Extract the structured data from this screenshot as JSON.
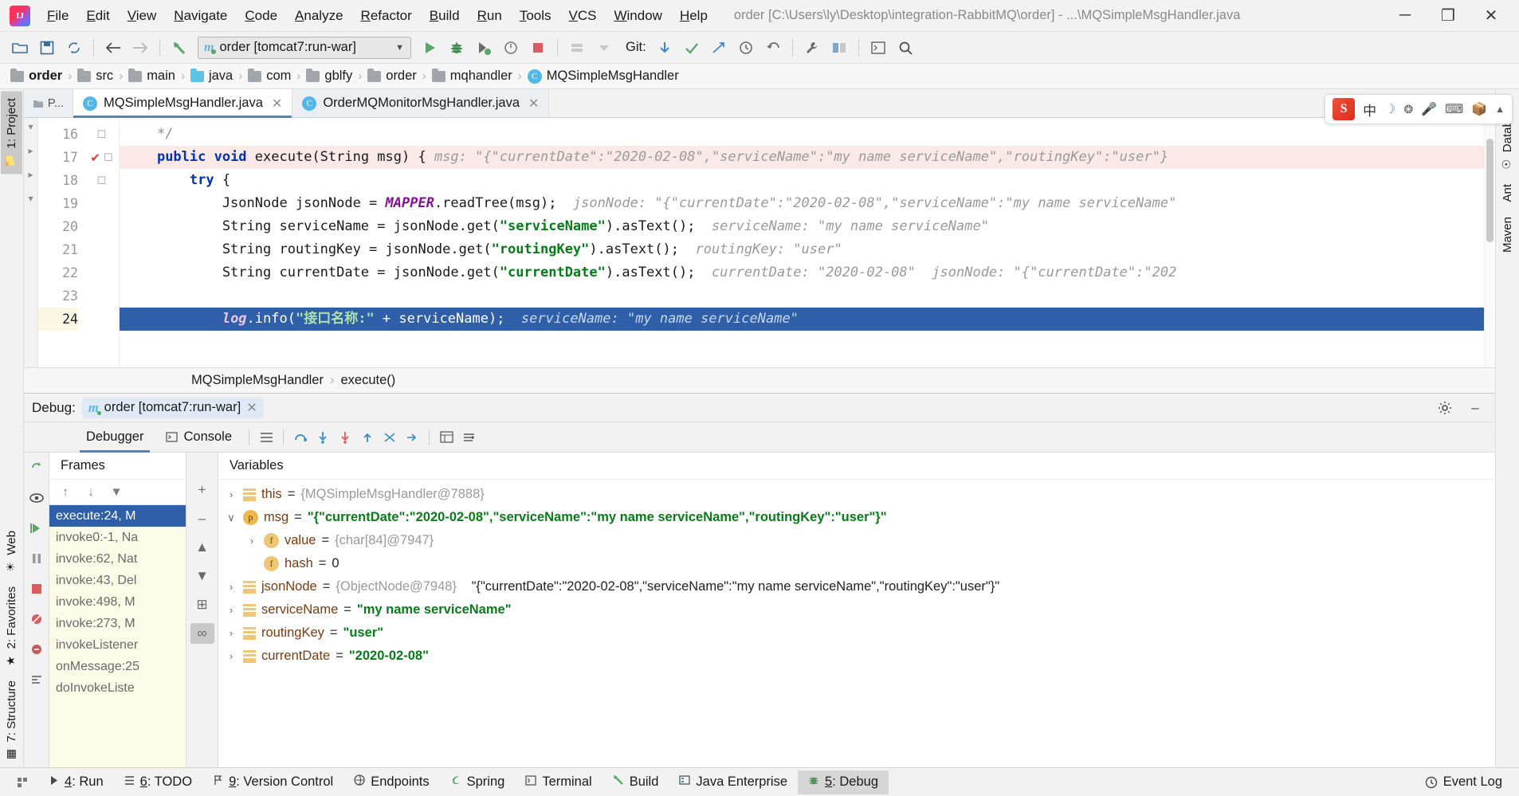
{
  "window": {
    "title": "order [C:\\Users\\ly\\Desktop\\integration-RabbitMQ\\order] - ...\\MQSimpleMsgHandler.java",
    "minimize": "─",
    "maximize": "❐",
    "close": "✕"
  },
  "menu": {
    "items": [
      "File",
      "Edit",
      "View",
      "Navigate",
      "Code",
      "Analyze",
      "Refactor",
      "Build",
      "Run",
      "Tools",
      "VCS",
      "Window",
      "Help"
    ]
  },
  "toolbar": {
    "run_config": "order [tomcat7:run-war]",
    "run_config_prefix": "m",
    "git_label": "Git:",
    "icons": [
      "open-folder-icon",
      "save-icon",
      "sync-icon",
      "back-arrow-icon",
      "forward-arrow-icon",
      "undo-arrow-icon",
      "run-icon",
      "debug-icon",
      "run-with-coverage-icon",
      "profile-icon",
      "stop-icon",
      "build-icon",
      "build-variant-icon",
      "git-update-icon",
      "git-commit-icon",
      "git-push-icon",
      "history-icon",
      "rollback-icon",
      "wrench-icon",
      "layout-icon",
      "terminal-icon",
      "search-icon"
    ]
  },
  "breadcrumb": {
    "items": [
      {
        "label": "order",
        "icon": "folder-icon"
      },
      {
        "label": "src",
        "icon": "folder-icon"
      },
      {
        "label": "main",
        "icon": "folder-icon"
      },
      {
        "label": "java",
        "icon": "folder-java-icon"
      },
      {
        "label": "com",
        "icon": "folder-icon"
      },
      {
        "label": "gblfy",
        "icon": "folder-icon"
      },
      {
        "label": "order",
        "icon": "folder-icon"
      },
      {
        "label": "mqhandler",
        "icon": "folder-icon"
      },
      {
        "label": "MQSimpleMsgHandler",
        "icon": "class-icon"
      }
    ],
    "separator": "›"
  },
  "editor_tabs": {
    "stub": "P...",
    "tabs": [
      {
        "label": "MQSimpleMsgHandler.java",
        "active": true,
        "close": "✕",
        "icon": "java-class-icon"
      },
      {
        "label": "OrderMQMonitorMsgHandler.java",
        "active": false,
        "close": "✕",
        "icon": "java-class-icon"
      }
    ]
  },
  "editor": {
    "line_numbers": [
      "16",
      "17",
      "18",
      "19",
      "20",
      "21",
      "22",
      "23",
      "24"
    ],
    "lines": [
      {
        "no": "16",
        "indent": 4,
        "segments": [
          {
            "t": "*/",
            "c": "cmt"
          }
        ],
        "style": "normal"
      },
      {
        "no": "17",
        "indent": 4,
        "segments": [
          {
            "t": "public void ",
            "c": "kw"
          },
          {
            "t": "execute(String msg) { ",
            "c": "plain"
          },
          {
            "t": "msg: \"{\"currentDate\":\"2020-02-08\",\"serviceName\":\"my name serviceName\",\"routingKey\":\"user\"}",
            "c": "hint"
          }
        ],
        "style": "pink"
      },
      {
        "no": "18",
        "indent": 8,
        "segments": [
          {
            "t": "try ",
            "c": "kw"
          },
          {
            "t": "{",
            "c": "plain"
          }
        ],
        "style": "normal"
      },
      {
        "no": "19",
        "indent": 12,
        "segments": [
          {
            "t": "JsonNode jsonNode = ",
            "c": "plain"
          },
          {
            "t": "MAPPER",
            "c": "fld"
          },
          {
            "t": ".readTree(msg);  ",
            "c": "plain"
          },
          {
            "t": "jsonNode: \"{\"currentDate\":\"2020-02-08\",\"serviceName\":\"my name serviceName\"",
            "c": "hint"
          }
        ],
        "style": "normal"
      },
      {
        "no": "20",
        "indent": 12,
        "segments": [
          {
            "t": "String serviceName = jsonNode.get(",
            "c": "plain"
          },
          {
            "t": "\"serviceName\"",
            "c": "str"
          },
          {
            "t": ").asText();  ",
            "c": "plain"
          },
          {
            "t": "serviceName: \"my name serviceName\"",
            "c": "hint"
          }
        ],
        "style": "normal"
      },
      {
        "no": "21",
        "indent": 12,
        "segments": [
          {
            "t": "String routingKey = jsonNode.get(",
            "c": "plain"
          },
          {
            "t": "\"routingKey\"",
            "c": "str"
          },
          {
            "t": ").asText();  ",
            "c": "plain"
          },
          {
            "t": "routingKey: \"user\"",
            "c": "hint"
          }
        ],
        "style": "normal"
      },
      {
        "no": "22",
        "indent": 12,
        "segments": [
          {
            "t": "String currentDate = jsonNode.get(",
            "c": "plain"
          },
          {
            "t": "\"currentDate\"",
            "c": "str"
          },
          {
            "t": ").asText();  ",
            "c": "plain"
          },
          {
            "t": "currentDate: \"2020-02-08\"  jsonNode: \"{\"currentDate\":\"202",
            "c": "hint"
          }
        ],
        "style": "normal"
      },
      {
        "no": "23",
        "indent": 12,
        "segments": [
          {
            "t": "",
            "c": "plain"
          }
        ],
        "style": "normal"
      },
      {
        "no": "24",
        "indent": 12,
        "segments": [
          {
            "t": "log",
            "c": "fld"
          },
          {
            "t": ".info(",
            "c": "plain"
          },
          {
            "t": "\"接口名称:\"",
            "c": "str"
          },
          {
            "t": " + serviceName);  ",
            "c": "plain"
          },
          {
            "t": "serviceName: \"my name serviceName\"",
            "c": "hint"
          }
        ],
        "style": "selected"
      }
    ],
    "footer_breadcrumb": [
      "MQSimpleMsgHandler",
      "execute()"
    ],
    "footer_separator": "›"
  },
  "debug": {
    "label": "Debug:",
    "session": "order [tomcat7:run-war]",
    "session_prefix": "m",
    "session_close": "✕",
    "settings_icon": "gear-icon",
    "minimize_icon": "minimize-icon",
    "tabs": [
      {
        "label": "Debugger",
        "active": true,
        "icon": "debugger-icon"
      },
      {
        "label": "Console",
        "active": false,
        "icon": "console-icon"
      }
    ],
    "toolbar_icons": [
      "layout-icon",
      "restore-layout-icon",
      "step-over-icon",
      "step-into-icon",
      "force-step-into-icon",
      "step-out-icon",
      "drop-frame-icon",
      "run-to-cursor-icon",
      "evaluate-icon",
      "settings-icon"
    ],
    "side_icons": [
      "rerun-icon",
      "eye-icon",
      "resume-icon",
      "pause-icon",
      "stop-icon",
      "mute-breakpoints-icon",
      "view-breakpoints-icon",
      "settings-icon"
    ],
    "frames": {
      "title": "Frames",
      "tools": [
        "up-arrow-icon",
        "down-arrow-icon",
        "filter-icon"
      ],
      "items": [
        {
          "label": "execute:24, M",
          "active": true
        },
        {
          "label": "invoke0:-1, Na",
          "active": false
        },
        {
          "label": "invoke:62, Nat",
          "active": false
        },
        {
          "label": "invoke:43, Del",
          "active": false
        },
        {
          "label": "invoke:498, M",
          "active": false
        },
        {
          "label": "invoke:273, M",
          "active": false
        },
        {
          "label": "invokeListener",
          "active": false
        },
        {
          "label": "onMessage:25",
          "active": false
        },
        {
          "label": "doInvokeListe",
          "active": false
        }
      ]
    },
    "variables": {
      "title": "Variables",
      "buttons": [
        "add-icon",
        "remove-icon",
        "move-up-icon",
        "move-down-icon",
        "copy-icon",
        "watches-icon"
      ],
      "rows": [
        {
          "arrow": "›",
          "badge": "list",
          "name": "this",
          "eq": " = ",
          "value": "{MQSimpleMsgHandler@7888}",
          "value_class": "ref",
          "indent": 0
        },
        {
          "arrow": "∨",
          "badge": "p",
          "name": "msg",
          "eq": " = ",
          "value": "\"{\"currentDate\":\"2020-02-08\",\"serviceName\":\"my name serviceName\",\"routingKey\":\"user\"}\"",
          "value_class": "str",
          "indent": 0
        },
        {
          "arrow": "›",
          "badge": "f",
          "name": "value",
          "eq": " = ",
          "value": "{char[84]@7947}",
          "value_class": "ref",
          "indent": 1
        },
        {
          "arrow": "",
          "badge": "f",
          "name": "hash",
          "eq": " = ",
          "value": "0",
          "value_class": "plain",
          "indent": 1
        },
        {
          "arrow": "›",
          "badge": "list",
          "name": "jsonNode",
          "eq": " = ",
          "value": "{ObjectNode@7948}",
          "value_class": "ref",
          "value2": "\"{\"currentDate\":\"2020-02-08\",\"serviceName\":\"my name serviceName\",\"routingKey\":\"user\"}\"",
          "value2_class": "plain",
          "indent": 0
        },
        {
          "arrow": "›",
          "badge": "list",
          "name": "serviceName",
          "eq": " = ",
          "value": "\"my name serviceName\"",
          "value_class": "str",
          "indent": 0
        },
        {
          "arrow": "›",
          "badge": "list",
          "name": "routingKey",
          "eq": " = ",
          "value": "\"user\"",
          "value_class": "str",
          "indent": 0
        },
        {
          "arrow": "›",
          "badge": "list",
          "name": "currentDate",
          "eq": " = ",
          "value": "\"2020-02-08\"",
          "value_class": "str",
          "indent": 0
        }
      ]
    }
  },
  "left_strip": {
    "items": [
      {
        "label": "1: Project",
        "active": true,
        "icon": "project-folder-icon"
      },
      {
        "label": "Web",
        "active": false,
        "icon": "web-icon"
      },
      {
        "label": "2: Favorites",
        "active": false,
        "icon": "star-icon"
      },
      {
        "label": "7: Structure",
        "active": false,
        "icon": "structure-icon"
      }
    ]
  },
  "right_strip": {
    "items": [
      {
        "label": "Database",
        "icon": "database-icon"
      },
      {
        "label": "Ant",
        "icon": "ant-icon"
      },
      {
        "label": "Maven",
        "icon": "maven-icon"
      }
    ]
  },
  "statusbar": {
    "items": [
      {
        "num": "4",
        "label": ": Run",
        "icon": "run-icon",
        "active": false
      },
      {
        "num": "6",
        "label": ": TODO",
        "icon": "todo-icon",
        "active": false
      },
      {
        "num": "9",
        "label": ": Version Control",
        "icon": "vcs-icon",
        "active": false
      },
      {
        "num": "",
        "label": "Endpoints",
        "icon": "endpoints-icon",
        "active": false
      },
      {
        "num": "",
        "label": "Spring",
        "icon": "spring-icon",
        "active": false
      },
      {
        "num": "",
        "label": "Terminal",
        "icon": "terminal-icon",
        "active": false
      },
      {
        "num": "",
        "label": "Build",
        "icon": "build-icon",
        "active": false
      },
      {
        "num": "",
        "label": "Java Enterprise",
        "icon": "java-enterprise-icon",
        "active": false
      },
      {
        "num": "5",
        "label": ": Debug",
        "icon": "debug-icon",
        "active": true
      }
    ],
    "event_log": "Event Log",
    "event_log_icon": "event-log-icon"
  },
  "ime": {
    "logo": "S",
    "items": [
      "中",
      "☽",
      "❂",
      "Ἲ4",
      "⌨",
      "✂",
      "▲"
    ]
  },
  "colors": {
    "accent": "#4a86c7",
    "selection": "#2f5fa8",
    "string": "#067d17",
    "keyword": "#0033b3",
    "field": "#871094",
    "hint": "#9a9a9a",
    "exec_pink": "#fbe9e7",
    "frames_bg": "#fbfbe8"
  }
}
